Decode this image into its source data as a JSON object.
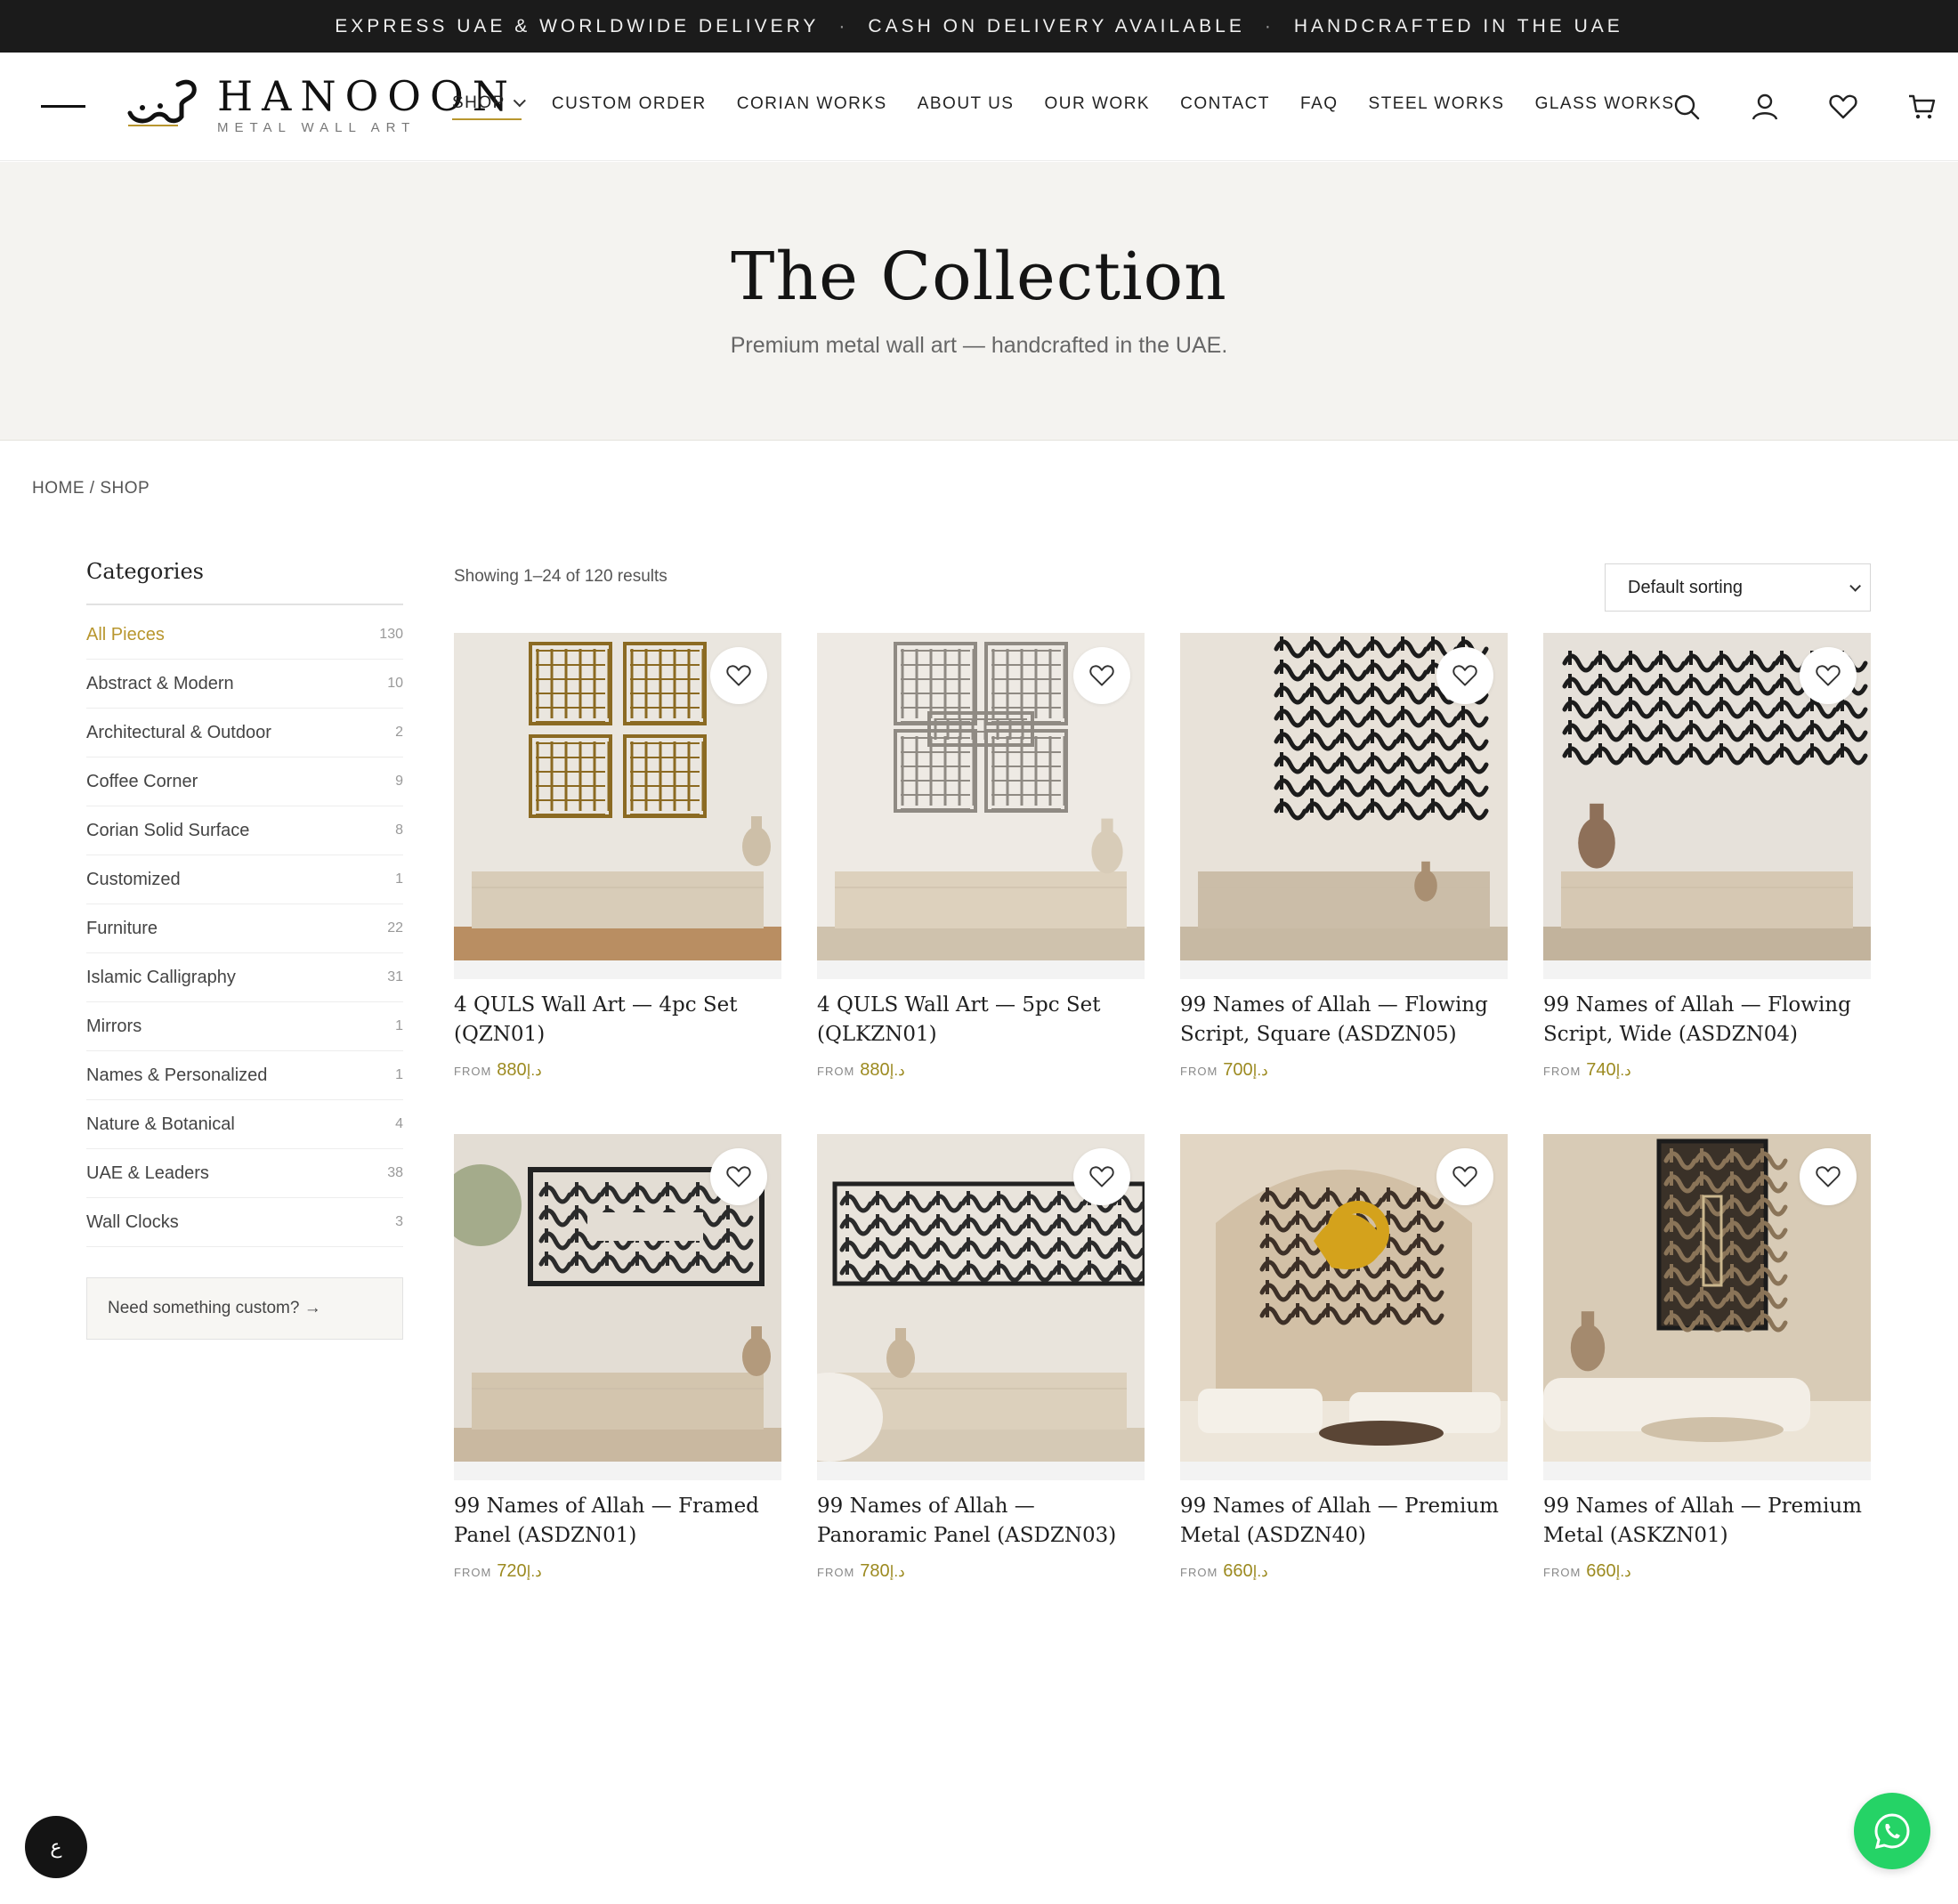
{
  "announcement": {
    "item1": "EXPRESS UAE & WORLDWIDE DELIVERY",
    "sep": "·",
    "item2": "CASH ON DELIVERY AVAILABLE",
    "item3": "HANDCRAFTED IN THE UAE"
  },
  "header": {
    "logo_title": "HANOOON",
    "logo_subtitle": "METAL WALL ART",
    "nav": [
      {
        "label": "SHOP"
      },
      {
        "label": "CUSTOM ORDER"
      },
      {
        "label": "CORIAN WORKS"
      },
      {
        "label": "ABOUT US"
      },
      {
        "label": "OUR WORK"
      },
      {
        "label": "CONTACT"
      },
      {
        "label": "FAQ"
      },
      {
        "label": "STEEL WORKS"
      },
      {
        "label": "GLASS WORKS"
      }
    ],
    "icons": [
      "search-icon",
      "account-icon",
      "heart-icon",
      "cart-icon"
    ]
  },
  "hero": {
    "title": "The Collection",
    "subtitle": "Premium metal wall art — handcrafted in the UAE."
  },
  "breadcrumb": {
    "home": "HOME",
    "sep": " / ",
    "current": "SHOP"
  },
  "sidebar": {
    "title": "Categories",
    "categories": [
      {
        "label": "All Pieces",
        "count": "130",
        "active": true
      },
      {
        "label": "Abstract & Modern",
        "count": "10"
      },
      {
        "label": "Architectural & Outdoor",
        "count": "2"
      },
      {
        "label": "Coffee Corner",
        "count": "9"
      },
      {
        "label": "Corian Solid Surface",
        "count": "8"
      },
      {
        "label": "Customized",
        "count": "1"
      },
      {
        "label": "Furniture",
        "count": "22"
      },
      {
        "label": "Islamic Calligraphy",
        "count": "31"
      },
      {
        "label": "Mirrors",
        "count": "1"
      },
      {
        "label": "Names & Personalized",
        "count": "1"
      },
      {
        "label": "Nature & Botanical",
        "count": "4"
      },
      {
        "label": "UAE & Leaders",
        "count": "38"
      },
      {
        "label": "Wall Clocks",
        "count": "3"
      }
    ],
    "custom_link": "Need something custom? →"
  },
  "results": {
    "count_text": "Showing 1–24 of 120 results",
    "sort_selected": "Default sorting"
  },
  "price_prefix": "FROM",
  "currency": "د.إ",
  "products": [
    {
      "title": "4 QULS Wall Art — 4pc Set (QZN01)",
      "price": "880",
      "art": "gold-squares"
    },
    {
      "title": "4 QULS Wall Art — 5pc Set (QLKZN01)",
      "price": "880",
      "art": "silver-kufic"
    },
    {
      "title": "99 Names of Allah — Flowing Script, Square (ASDZN05)",
      "price": "700",
      "art": "black-script"
    },
    {
      "title": "99 Names of Allah — Flowing Script, Wide (ASDZN04)",
      "price": "740",
      "art": "black-wide"
    },
    {
      "title": "99 Names of Allah — Framed Panel (ASDZN01)",
      "price": "720",
      "art": "framed-panel"
    },
    {
      "title": "99 Names of Allah — Panoramic Panel (ASDZN03)",
      "price": "780",
      "art": "panoramic"
    },
    {
      "title": "99 Names of Allah — Premium Metal (ASDZN40)",
      "price": "660",
      "art": "gold-hu"
    },
    {
      "title": "99 Names of Allah — Premium Metal (ASKZN01)",
      "price": "660",
      "art": "vertical-panel"
    }
  ],
  "floating": {
    "lang_label": "ع"
  },
  "colors": {
    "accent": "#b8962e",
    "price": "#9c8a20",
    "topbar": "#1b1b1b",
    "hero_bg": "#f4f3f0",
    "whatsapp": "#25d366"
  }
}
